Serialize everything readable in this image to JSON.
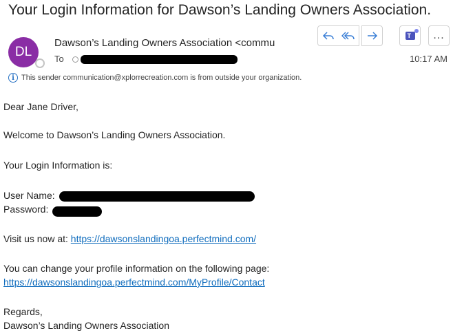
{
  "email": {
    "subject": "Your Login Information for Dawson’s Landing Owners Association.",
    "avatar_initials": "DL",
    "sender": "Dawson’s Landing Owners Association <commu",
    "to_label": "To",
    "time": "10:17 AM",
    "external_notice": "This sender communication@xplorrecreation.com is from outside your organization."
  },
  "toolbar": {
    "reply_icon": "reply-icon",
    "reply_all_icon": "reply-all-icon",
    "forward_icon": "forward-icon",
    "teams_icon": "teams-icon",
    "more_label": "..."
  },
  "body": {
    "greeting": "Dear Jane Driver,",
    "welcome": "Welcome to Dawson’s Landing Owners Association.",
    "login_intro": "Your Login Information is:",
    "username_label": "User Name:",
    "password_label": "Password:",
    "visit_text": "Visit us now at:",
    "visit_link": "https://dawsonslandingoa.perfectmind.com/",
    "profile_text": "You can change your profile information on the following page:",
    "profile_link": "https://dawsonslandingoa.perfectmind.com/MyProfile/Contact",
    "regards": "Regards,",
    "signature": "Dawson’s Landing Owners Association"
  },
  "colors": {
    "avatar": "#8a2da5",
    "accent": "#0f6cbd",
    "icon_blue": "#3a7fd6"
  }
}
